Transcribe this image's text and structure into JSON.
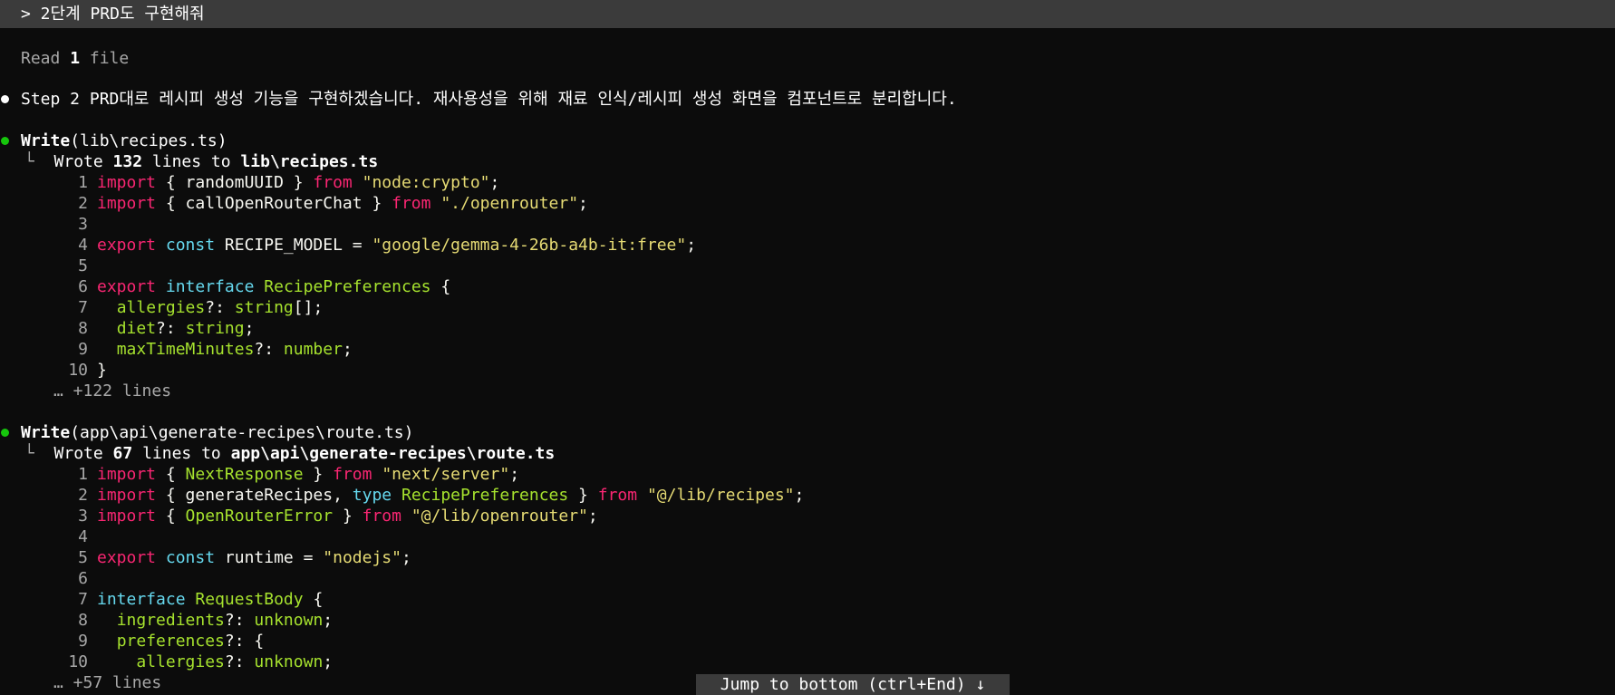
{
  "prompt": {
    "text": "> 2단계 PRD도 구현해줘"
  },
  "read_status": {
    "prefix": "Read ",
    "count": "1",
    "suffix": " file"
  },
  "message": {
    "text": "Step 2 PRD대로 레시피 생성 기능을 구현하겠습니다. 재사용성을 위해 재료 인식/레시피 생성 화면을 컴포넌트로 분리합니다."
  },
  "writes": [
    {
      "tool": "Write",
      "arg": "(lib\\recipes.ts)",
      "result_prefix": "Wrote ",
      "result_count": "132",
      "result_mid": " lines to ",
      "result_path": "lib\\recipes.ts",
      "more": "… +122 lines",
      "lines": [
        {
          "n": "1",
          "tokens": [
            [
              "kw-pink",
              "import"
            ],
            [
              "plain",
              " { randomUUID } "
            ],
            [
              "kw-pink",
              "from"
            ],
            [
              "plain",
              " "
            ],
            [
              "str-yellow",
              "\"node:crypto\""
            ],
            [
              "plain",
              ";"
            ]
          ]
        },
        {
          "n": "2",
          "tokens": [
            [
              "kw-pink",
              "import"
            ],
            [
              "plain",
              " { callOpenRouterChat } "
            ],
            [
              "kw-pink",
              "from"
            ],
            [
              "plain",
              " "
            ],
            [
              "str-yellow",
              "\"./openrouter\""
            ],
            [
              "plain",
              ";"
            ]
          ]
        },
        {
          "n": "3",
          "tokens": []
        },
        {
          "n": "4",
          "tokens": [
            [
              "kw-pink",
              "export"
            ],
            [
              "plain",
              " "
            ],
            [
              "kw-cyan",
              "const"
            ],
            [
              "plain",
              " RECIPE_MODEL = "
            ],
            [
              "str-yellow",
              "\"google/gemma-4-26b-a4b-it:free\""
            ],
            [
              "plain",
              ";"
            ]
          ]
        },
        {
          "n": "5",
          "tokens": []
        },
        {
          "n": "6",
          "tokens": [
            [
              "kw-pink",
              "export"
            ],
            [
              "plain",
              " "
            ],
            [
              "kw-cyan",
              "interface"
            ],
            [
              "plain",
              " "
            ],
            [
              "ty-green",
              "RecipePreferences"
            ],
            [
              "plain",
              " {"
            ]
          ]
        },
        {
          "n": "7",
          "tokens": [
            [
              "plain",
              "  "
            ],
            [
              "ty-green",
              "allergies"
            ],
            [
              "plain",
              "?: "
            ],
            [
              "ty-green",
              "string"
            ],
            [
              "plain",
              "[];"
            ]
          ]
        },
        {
          "n": "8",
          "tokens": [
            [
              "plain",
              "  "
            ],
            [
              "ty-green",
              "diet"
            ],
            [
              "plain",
              "?: "
            ],
            [
              "ty-green",
              "string"
            ],
            [
              "plain",
              ";"
            ]
          ]
        },
        {
          "n": "9",
          "tokens": [
            [
              "plain",
              "  "
            ],
            [
              "ty-green",
              "maxTimeMinutes"
            ],
            [
              "plain",
              "?: "
            ],
            [
              "ty-green",
              "number"
            ],
            [
              "plain",
              ";"
            ]
          ]
        },
        {
          "n": "10",
          "tokens": [
            [
              "plain",
              "}"
            ]
          ]
        }
      ]
    },
    {
      "tool": "Write",
      "arg": "(app\\api\\generate-recipes\\route.ts)",
      "result_prefix": "Wrote ",
      "result_count": "67",
      "result_mid": " lines to ",
      "result_path": "app\\api\\generate-recipes\\route.ts",
      "more": "… +57 lines",
      "lines": [
        {
          "n": "1",
          "tokens": [
            [
              "kw-pink",
              "import"
            ],
            [
              "plain",
              " { "
            ],
            [
              "ty-green",
              "NextResponse"
            ],
            [
              "plain",
              " } "
            ],
            [
              "kw-pink",
              "from"
            ],
            [
              "plain",
              " "
            ],
            [
              "str-yellow",
              "\"next/server\""
            ],
            [
              "plain",
              ";"
            ]
          ]
        },
        {
          "n": "2",
          "tokens": [
            [
              "kw-pink",
              "import"
            ],
            [
              "plain",
              " { generateRecipes, "
            ],
            [
              "kw-cyan",
              "type"
            ],
            [
              "plain",
              " "
            ],
            [
              "ty-green",
              "RecipePreferences"
            ],
            [
              "plain",
              " } "
            ],
            [
              "kw-pink",
              "from"
            ],
            [
              "plain",
              " "
            ],
            [
              "str-yellow",
              "\"@/lib/recipes\""
            ],
            [
              "plain",
              ";"
            ]
          ]
        },
        {
          "n": "3",
          "tokens": [
            [
              "kw-pink",
              "import"
            ],
            [
              "plain",
              " { "
            ],
            [
              "ty-green",
              "OpenRouterError"
            ],
            [
              "plain",
              " } "
            ],
            [
              "kw-pink",
              "from"
            ],
            [
              "plain",
              " "
            ],
            [
              "str-yellow",
              "\"@/lib/openrouter\""
            ],
            [
              "plain",
              ";"
            ]
          ]
        },
        {
          "n": "4",
          "tokens": []
        },
        {
          "n": "5",
          "tokens": [
            [
              "kw-pink",
              "export"
            ],
            [
              "plain",
              " "
            ],
            [
              "kw-cyan",
              "const"
            ],
            [
              "plain",
              " runtime = "
            ],
            [
              "str-yellow",
              "\"nodejs\""
            ],
            [
              "plain",
              ";"
            ]
          ]
        },
        {
          "n": "6",
          "tokens": []
        },
        {
          "n": "7",
          "tokens": [
            [
              "kw-cyan",
              "interface"
            ],
            [
              "plain",
              " "
            ],
            [
              "ty-green",
              "RequestBody"
            ],
            [
              "plain",
              " {"
            ]
          ]
        },
        {
          "n": "8",
          "tokens": [
            [
              "plain",
              "  "
            ],
            [
              "ty-green",
              "ingredients"
            ],
            [
              "plain",
              "?: "
            ],
            [
              "ty-green",
              "unknown"
            ],
            [
              "plain",
              ";"
            ]
          ]
        },
        {
          "n": "9",
          "tokens": [
            [
              "plain",
              "  "
            ],
            [
              "ty-green",
              "preferences"
            ],
            [
              "plain",
              "?: {"
            ]
          ]
        },
        {
          "n": "10",
          "tokens": [
            [
              "plain",
              "    "
            ],
            [
              "ty-green",
              "allergies"
            ],
            [
              "plain",
              "?: "
            ],
            [
              "ty-green",
              "unknown"
            ],
            [
              "plain",
              ";"
            ]
          ]
        }
      ]
    }
  ],
  "jump_button": {
    "label": "Jump to bottom (ctrl+End) ↓"
  },
  "colors": {
    "background": "#0c0c0c",
    "prompt_bar": "#3b3b3b",
    "bullet_green": "#16c60c",
    "keyword_pink": "#f92672",
    "keyword_cyan": "#66d9ef",
    "string_yellow": "#e6db74",
    "type_green": "#a6e22e"
  }
}
